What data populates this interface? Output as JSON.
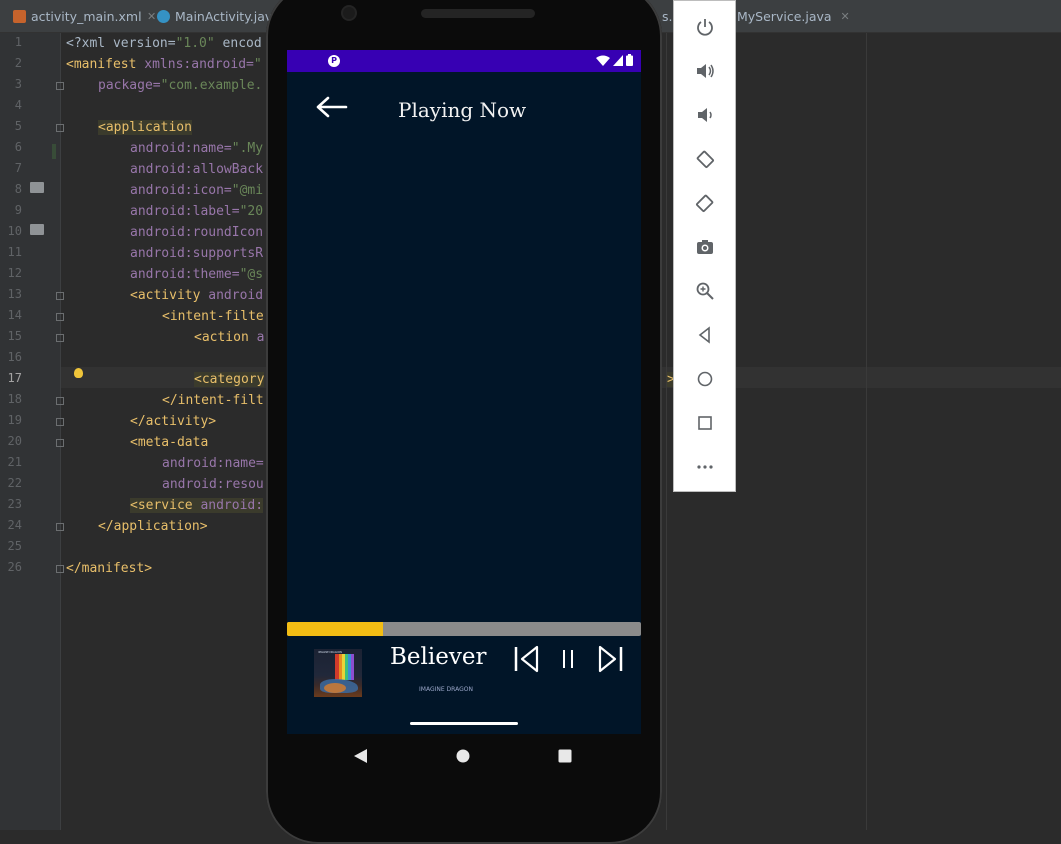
{
  "ide": {
    "tabs": [
      {
        "label": "activity_main.xml",
        "icon": "xml-file-icon"
      },
      {
        "label": "MainActivity.java",
        "icon": "java-class-icon"
      },
      {
        "label": "MyService.java",
        "icon": "java-class-icon"
      }
    ],
    "tab_fragment": "s.x",
    "line_numbers": [
      "1",
      "2",
      "3",
      "4",
      "5",
      "6",
      "7",
      "8",
      "9",
      "10",
      "11",
      "12",
      "13",
      "14",
      "15",
      "16",
      "17",
      "18",
      "19",
      "20",
      "21",
      "22",
      "23",
      "24",
      "25",
      "26"
    ],
    "code": {
      "l1": [
        "<?xml version=",
        "\"1.0\"",
        " encod"
      ],
      "l2": [
        "<manifest ",
        "xmlns:android=",
        "\""
      ],
      "l3": [
        "package=",
        "\"com.example."
      ],
      "l5": "<application",
      "l6": [
        "android:",
        "name=",
        "\".My"
      ],
      "l7": [
        "android:",
        "allowBack"
      ],
      "l8": [
        "android:",
        "icon=",
        "\"@mi"
      ],
      "l9": [
        "android:",
        "label=",
        "\"20"
      ],
      "l10": [
        "android:",
        "roundIcon"
      ],
      "l11": [
        "android:",
        "supportsR"
      ],
      "l12": [
        "android:",
        "theme=",
        "\"@s"
      ],
      "l13": [
        "<activity ",
        "android"
      ],
      "l14": "<intent-filte",
      "l15": [
        "<action ",
        "a"
      ],
      "l17": "<category",
      "l17_right": ">",
      "l18": "</intent-filt",
      "l19": "</activity>",
      "l20": "<meta-data",
      "l21": [
        "android:",
        "name="
      ],
      "l22": [
        "android:",
        "resou"
      ],
      "l23": [
        "<service ",
        "android:"
      ],
      "l24": "</application>",
      "l26": "</manifest>"
    }
  },
  "emulator": {
    "screen_title": "Playing Now",
    "player": {
      "song_title": "Believer",
      "artist": "IMAGINE DRAGON",
      "progress_fraction": 0.27,
      "album_art_text": "IMAGINE DRAGONS"
    },
    "colors": {
      "status_bar": "#3700b3",
      "screen_bg": "#011528",
      "progress_fill": "#f3bd14",
      "progress_track": "#8b8b8b"
    },
    "side_toolbar": [
      "power-icon",
      "volume-up-icon",
      "volume-down-icon",
      "rotate-left-icon",
      "rotate-right-icon",
      "screenshot-camera-icon",
      "zoom-icon",
      "back-triangle-icon",
      "home-circle-icon",
      "overview-square-icon",
      "more-dots-icon"
    ],
    "nav_buttons": [
      "back-icon",
      "home-icon",
      "recents-icon"
    ]
  }
}
